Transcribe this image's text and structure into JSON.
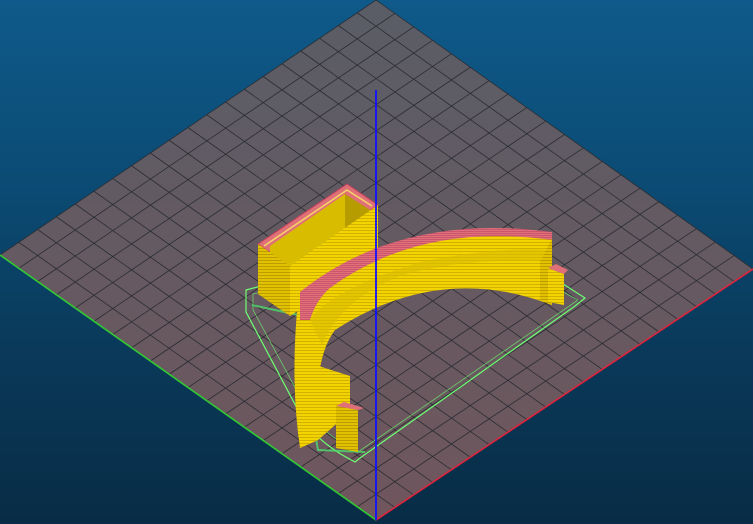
{
  "viewport": {
    "background_top": "#0f5a8a",
    "background_bottom": "#082c45"
  },
  "bed": {
    "grid_divisions": 20,
    "fill_colors": [
      "#5a5d66",
      "#70565d"
    ],
    "grid_line_color": "#2b2d33"
  },
  "axes": {
    "x_color": "#e0243c",
    "y_color": "#32c832",
    "z_color": "#1010ff"
  },
  "model": {
    "wall_color": "#f2d400",
    "perimeter_color": "#e07078",
    "skirt_color": "#6cff72"
  }
}
